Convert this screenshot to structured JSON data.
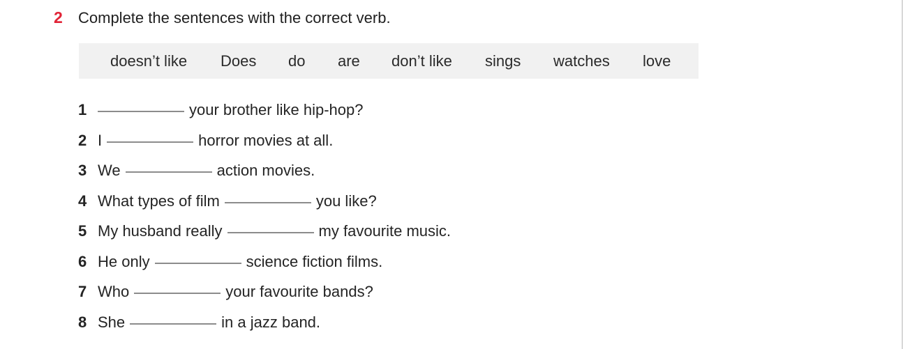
{
  "exercise": {
    "number": "2",
    "instruction": "Complete the sentences with the correct verb.",
    "word_bank": [
      "doesn’t like",
      "Does",
      "do",
      "are",
      "don’t like",
      "sings",
      "watches",
      "love"
    ],
    "items": [
      {
        "number": "1",
        "before": "",
        "after": "your brother like hip-hop?"
      },
      {
        "number": "2",
        "before": "I",
        "after": "horror movies at all."
      },
      {
        "number": "3",
        "before": "We",
        "after": "action movies."
      },
      {
        "number": "4",
        "before": "What types of film",
        "after": "you like?"
      },
      {
        "number": "5",
        "before": "My husband really",
        "after": "my favourite music."
      },
      {
        "number": "6",
        "before": "He only",
        "after": "science fiction films."
      },
      {
        "number": "7",
        "before": "Who",
        "after": "your favourite bands?"
      },
      {
        "number": "8",
        "before": "She",
        "after": "in a jazz band."
      }
    ]
  }
}
